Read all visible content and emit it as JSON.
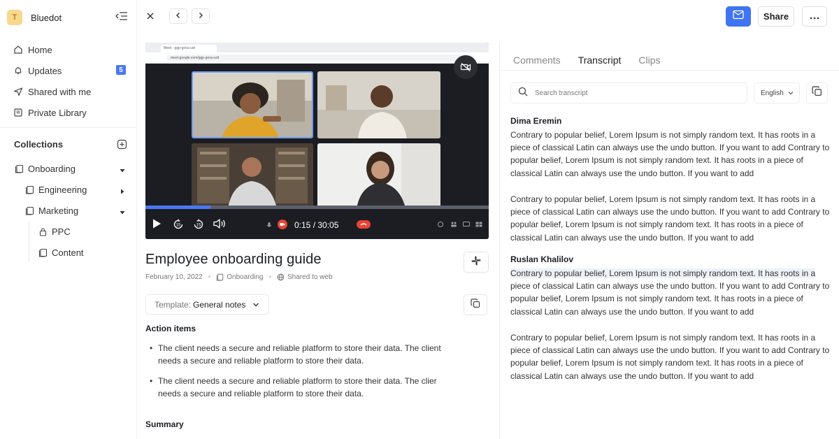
{
  "workspace": {
    "initial": "T",
    "name": "Bluedot"
  },
  "sidebar": {
    "items": [
      {
        "label": "Home",
        "icon": "home-icon"
      },
      {
        "label": "Updates",
        "icon": "bell-icon",
        "badge": "5"
      },
      {
        "label": "Shared with me",
        "icon": "send-icon"
      },
      {
        "label": "Private Library",
        "icon": "library-icon"
      }
    ],
    "collections_title": "Collections",
    "tree": [
      {
        "label": "Onboarding",
        "icon": "folder-icon",
        "state": "expanded"
      },
      {
        "label": "Engineering",
        "icon": "folder-icon",
        "state": "collapsed"
      },
      {
        "label": "Marketing",
        "icon": "folder-icon",
        "state": "expanded"
      },
      {
        "label": "PPC",
        "icon": "lock-icon"
      },
      {
        "label": "Content",
        "icon": "folder-icon"
      }
    ]
  },
  "topbar": {
    "share_label": "Share"
  },
  "video": {
    "time_display": "0:15 / 30:05",
    "progress": 0.19,
    "browser_tab": "Meet - ggp-gosu-udr",
    "browser_url": "meet.google.com/ggp-gosu-udr"
  },
  "doc": {
    "title": "Employee onboarding guide",
    "date": "February 10, 2022",
    "collection": "Onboarding",
    "share_status": "Shared to web",
    "template_label": "Template:",
    "template_value": "General notes",
    "action_items_title": "Action items",
    "action_items": [
      "The client needs a secure and reliable platform to store their data. The client needs a secure and reliable platform to store their data.",
      "The client needs a secure and reliable platform to store their data. The clier needs a secure and reliable platform to store their data."
    ],
    "summary_title": "Summary"
  },
  "panel": {
    "tabs": [
      "Comments",
      "Transcript",
      "Clips"
    ],
    "active_tab": "Transcript",
    "search_placeholder": "Search transcript",
    "language": "English"
  },
  "transcript": {
    "speaker1": "Dima Eremin",
    "speaker2": "Ruslan Khalilov",
    "p1": "Contrary to popular belief, Lorem Ipsum is not simply random text. It has roots in a piece of classical Latin can always use the undo button. If you want to add Contrary to popular belief, Lorem Ipsum is not simply random text. It has roots in a piece of classical Latin can always use the undo button. If you want to add",
    "p2": "Contrary to popular belief, Lorem Ipsum is not simply random text. It has roots in a piece of classical Latin can always use the undo button. If you want to add Contrary to popular belief, Lorem Ipsum is not simply random text. It has roots in a piece of classical Latin can always use the undo button. If you want to add",
    "p3_highlight": "Contrary to popular belief, Lorem Ipsum is not simply random text. It has roots in a",
    "p3_rest": " piece of classical Latin can always use the undo button. If you want to add Contrary to popular belief, Lorem Ipsum is not simply random text. It has roots in a piece of classical Latin can always use the undo button. If you want to add",
    "p4": "Contrary to popular belief, Lorem Ipsum is not simply random text. It has roots in a piece of classical Latin can always use the undo button. If you want to add Contrary to popular belief, Lorem Ipsum is not simply random text. It has roots in a piece of classical Latin can always use the undo button. If you want to add"
  },
  "colors": {
    "accent": "#3f74f3",
    "badge": "#4a77f6",
    "highlight": "#edf1f8"
  }
}
